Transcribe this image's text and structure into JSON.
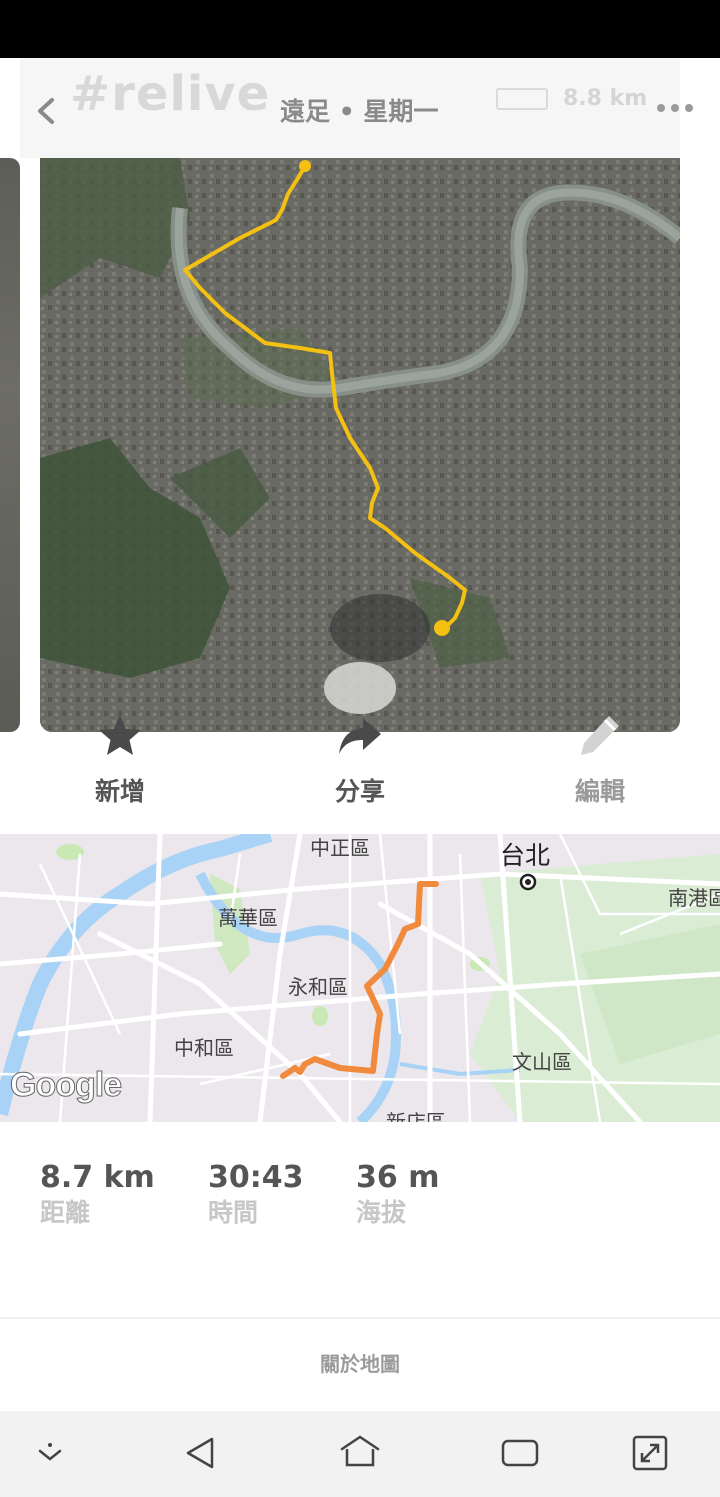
{
  "header": {
    "logo": "#relive",
    "title": "遠足 • 星期一",
    "distance_overlay": "8.8 km"
  },
  "actions": [
    {
      "label": "新增",
      "icon": "star-icon"
    },
    {
      "label": "分享",
      "icon": "share-icon"
    },
    {
      "label": "編輯",
      "icon": "pencil-icon"
    }
  ],
  "map": {
    "labels": {
      "zhongzheng": "中正區",
      "taipei": "台北",
      "wanhua": "萬華區",
      "nangang": "南港區",
      "yonghe": "永和區",
      "zhonghe": "中和區",
      "wenshan": "文山區",
      "xindian": "新店區"
    },
    "attribution": "Google"
  },
  "stats": [
    {
      "value": "8.7 km",
      "label": "距離"
    },
    {
      "value": "30:43",
      "label": "時間"
    },
    {
      "value": "36 m",
      "label": "海拔"
    }
  ],
  "footer": {
    "about_map": "關於地圖"
  },
  "colors": {
    "route_video": "#f4c012",
    "route_map": "#f08a3c",
    "river": "#8fc6f4",
    "park": "#c8e8b4"
  }
}
